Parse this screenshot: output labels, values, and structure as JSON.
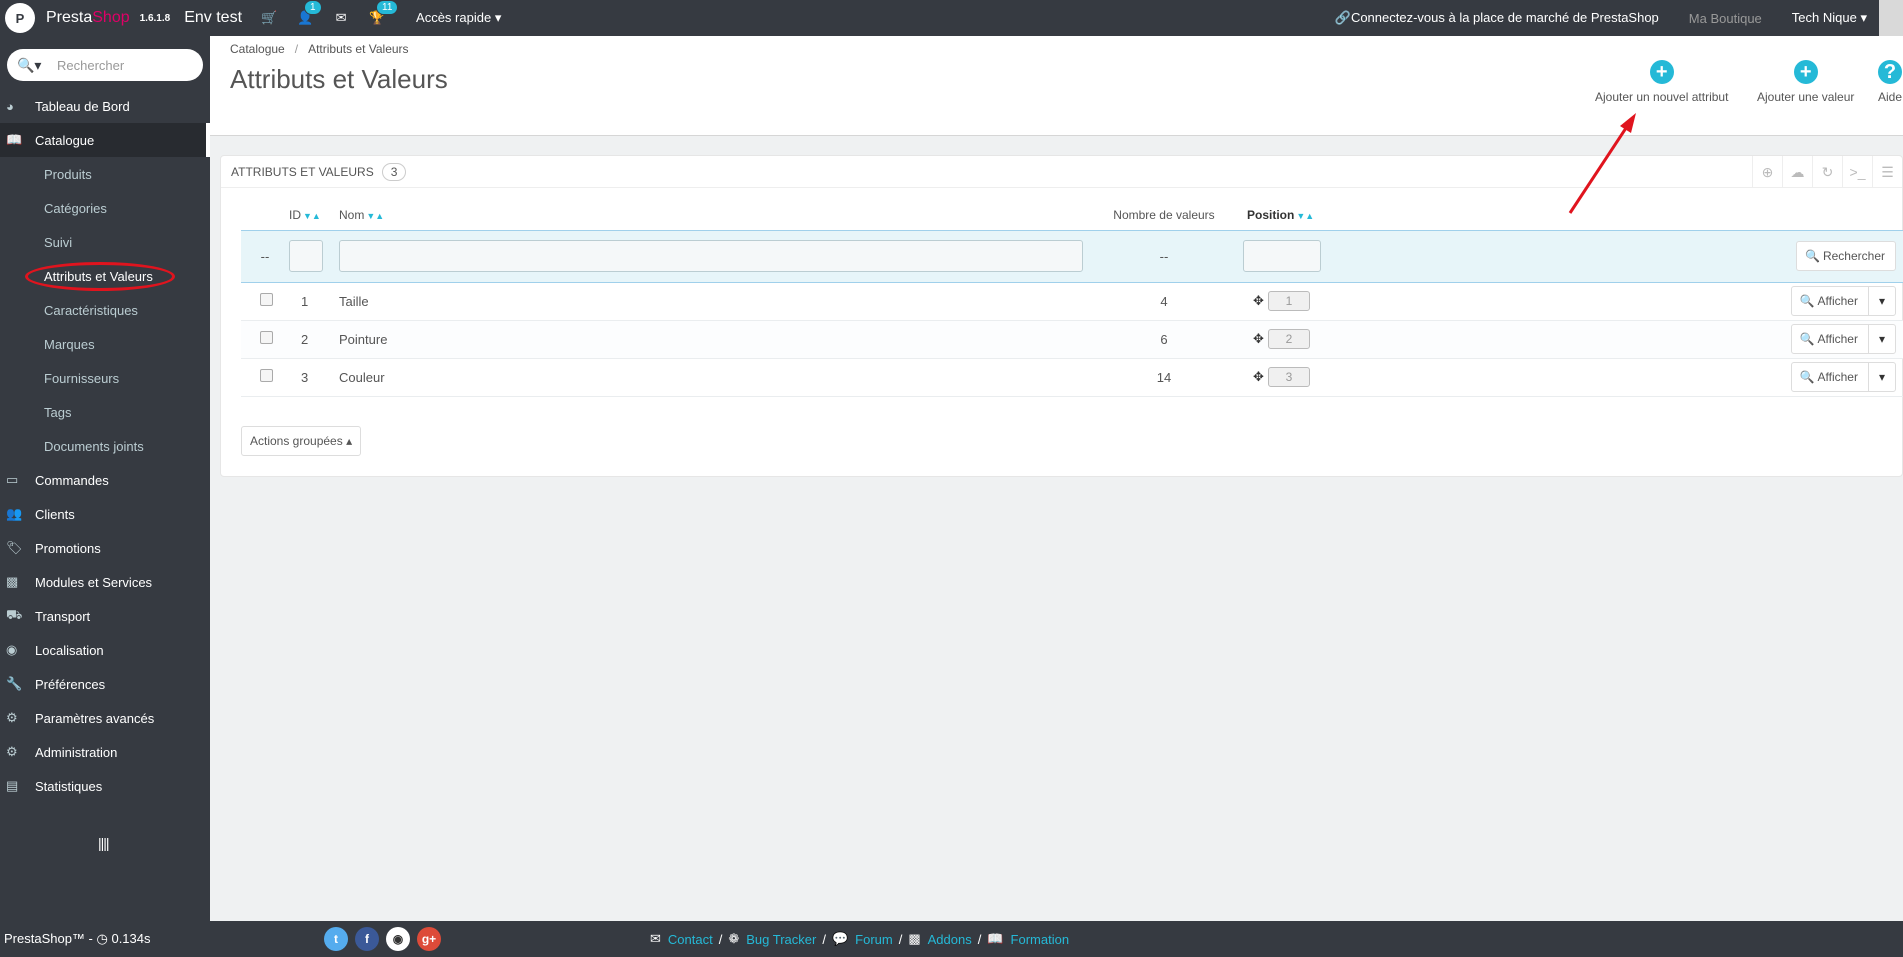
{
  "topbar": {
    "brand_first": "Presta",
    "brand_second": "Shop",
    "version": "1.6.1.8",
    "shop_name": "Env test",
    "customers_badge": "1",
    "trophy_badge": "11",
    "quick_access": "Accès rapide",
    "marketplace": "Connectez-vous à la place de marché de PrestaShop",
    "my_shop": "Ma Boutique",
    "employee": "Tech Nique"
  },
  "sidebar": {
    "search_placeholder": "Rechercher",
    "items": [
      {
        "label": "Tableau de Bord",
        "icon": "dashboard-icon"
      },
      {
        "label": "Catalogue",
        "icon": "book-icon"
      },
      {
        "label": "Commandes",
        "icon": "credit-card-icon"
      },
      {
        "label": "Clients",
        "icon": "users-icon"
      },
      {
        "label": "Promotions",
        "icon": "tags-icon"
      },
      {
        "label": "Modules et Services",
        "icon": "puzzle-icon"
      },
      {
        "label": "Transport",
        "icon": "truck-icon"
      },
      {
        "label": "Localisation",
        "icon": "globe-icon"
      },
      {
        "label": "Préférences",
        "icon": "wrench-icon"
      },
      {
        "label": "Paramètres avancés",
        "icon": "cogs-icon"
      },
      {
        "label": "Administration",
        "icon": "gear-icon"
      },
      {
        "label": "Statistiques",
        "icon": "bar-chart-icon"
      }
    ],
    "submenu": [
      {
        "label": "Produits"
      },
      {
        "label": "Catégories"
      },
      {
        "label": "Suivi"
      },
      {
        "label": "Attributs et Valeurs"
      },
      {
        "label": "Caractéristiques"
      },
      {
        "label": "Marques"
      },
      {
        "label": "Fournisseurs"
      },
      {
        "label": "Tags"
      },
      {
        "label": "Documents joints"
      }
    ]
  },
  "header": {
    "breadcrumb": [
      "Catalogue",
      "Attributs et Valeurs"
    ],
    "title": "Attributs et Valeurs",
    "toolbar": [
      {
        "label": "Ajouter un nouvel attribut",
        "icon": "+"
      },
      {
        "label": "Ajouter une valeur",
        "icon": "+"
      },
      {
        "label": "Aide",
        "icon": "?"
      }
    ]
  },
  "panel": {
    "title": "ATTRIBUTS ET VALEURS",
    "count": "3",
    "columns": {
      "id": "ID",
      "name": "Nom",
      "values": "Nombre de valeurs",
      "position": "Position"
    },
    "filter_placeholder_dash": "--",
    "search_button": "Rechercher",
    "rows": [
      {
        "id": "1",
        "name": "Taille",
        "values": "4",
        "position": "1",
        "action": "Afficher"
      },
      {
        "id": "2",
        "name": "Pointure",
        "values": "6",
        "position": "2",
        "action": "Afficher"
      },
      {
        "id": "3",
        "name": "Couleur",
        "values": "14",
        "position": "3",
        "action": "Afficher"
      }
    ],
    "bulk_actions": "Actions groupées"
  },
  "footer": {
    "version": "PrestaShop™ - ",
    "time": "0.134s",
    "links": [
      "Contact",
      "Bug Tracker",
      "Forum",
      "Addons",
      "Formation"
    ]
  },
  "colors": {
    "accent": "#25b9d7",
    "topbar": "#363a41",
    "annotation": "#e0141e"
  }
}
